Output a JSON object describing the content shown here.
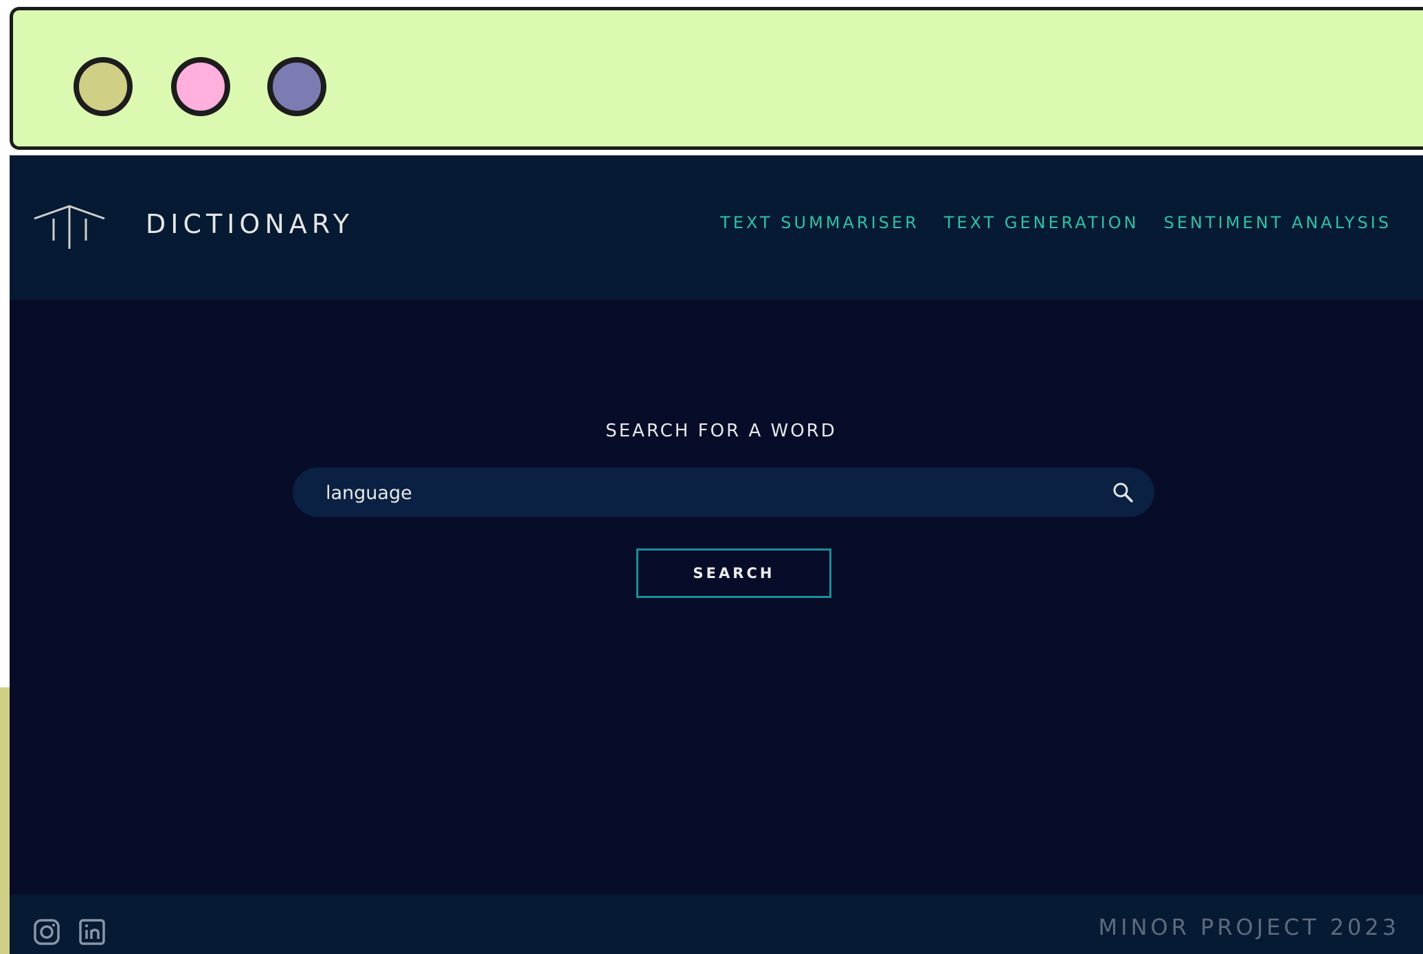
{
  "header": {
    "logo_icon": "pillar-logo-icon",
    "title": "DICTIONARY",
    "nav": [
      "TEXT SUMMARISER",
      "TEXT GENERATION",
      "SENTIMENT ANALYSIS"
    ]
  },
  "search": {
    "heading": "SEARCH FOR A WORD",
    "value": "language",
    "icon": "search-icon",
    "button_label": "SEARCH"
  },
  "footer": {
    "icons": [
      "instagram-icon",
      "linkedin-icon"
    ],
    "text": "MINOR PROJECT 2023"
  },
  "colors": {
    "chrome_bg": "#dcf9b2",
    "dot_1": "#cfcf86",
    "dot_2": "#ffb0dc",
    "dot_3": "#7c7bb2",
    "header_bg": "#071a33",
    "main_bg": "#070c28",
    "nav_accent": "#2fc2a6",
    "button_border": "#1b8f98"
  }
}
